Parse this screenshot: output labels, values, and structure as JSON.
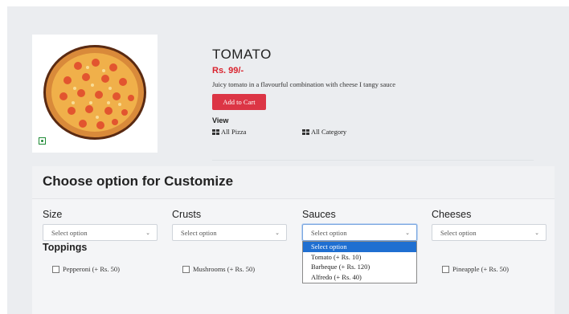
{
  "product": {
    "name": "TOMATO",
    "price": "Rs. 99/-",
    "description": "Juicy tomato in a flavourful combination with cheese I tangy sauce",
    "add_to_cart_label": "Add to Cart",
    "view_label": "View",
    "view_links": [
      "All Pizza",
      "All Category"
    ],
    "veg_indicator_color": "#1f8a36"
  },
  "customize": {
    "title": "Choose option for Customize",
    "fields": [
      {
        "label": "Size",
        "value": "Select option"
      },
      {
        "label": "Crusts",
        "value": "Select option"
      },
      {
        "label": "Sauces",
        "value": "Select option"
      },
      {
        "label": "Cheeses",
        "value": "Select option"
      }
    ],
    "sauce_dropdown_options": [
      "Select option",
      "Tomato (+ Rs. 10)",
      "Barbeque (+ Rs. 120)",
      "Alfredo (+ Rs. 40)"
    ],
    "toppings_label": "Toppings",
    "toppings": [
      "Pepperoni (+ Rs. 50)",
      "Mushrooms (+ Rs. 50)",
      "Pineapple (+ Rs. 50)"
    ]
  },
  "colors": {
    "accent": "#dc3545",
    "price": "#d9232e",
    "dropdown_highlight": "#1f6fd1"
  }
}
